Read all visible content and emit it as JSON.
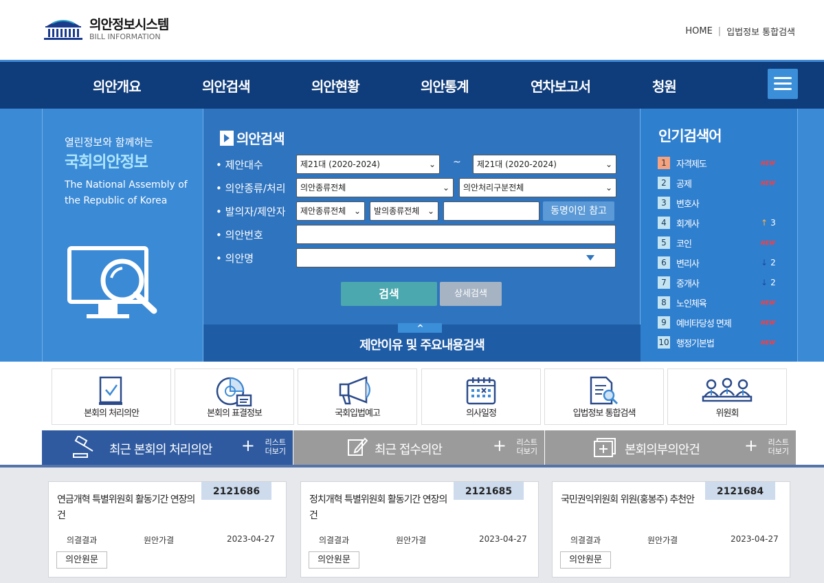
{
  "header": {
    "title": "의안정보시스템",
    "subtitle": "BILL INFORMATION",
    "util": [
      "HOME",
      "입법정보 통합검색"
    ],
    "util_sep": "|"
  },
  "nav": {
    "items": [
      "의안개요",
      "의안검색",
      "의안현황",
      "의안통계",
      "연차보고서",
      "청원"
    ],
    "menu_icon": "hamburger-icon"
  },
  "hero": {
    "line1": "열린정보와 함께하는",
    "line2": "국회의안정보",
    "line3": "The National Assembly of the Republic of Korea",
    "icon": "monitor-search-icon"
  },
  "search": {
    "title": "의안검색",
    "labels": [
      "제안대수",
      "의안종류/처리",
      "발의자/제안자",
      "의안번호",
      "의안명"
    ],
    "bullet": "•",
    "era_from": "제21대 (2020-2024)",
    "era_to": "제21대 (2020-2024)",
    "tilde": "~",
    "bill_type": "의안종류전체",
    "bill_proc": "의안처리구분전체",
    "proposer_type": "제안종류전체",
    "motion_type": "발의종류전체",
    "proposer_name": "",
    "bill_no": "",
    "bill_name": "",
    "same_name_btn": "동명이인 참고",
    "search_btn": "검색",
    "detail_btn": "상세검색",
    "reason_tab": "^",
    "reason_label": "제안이유 및 주요내용검색"
  },
  "popular": {
    "title": "인기검색어",
    "items": [
      {
        "rank": "1",
        "word": "자격제도",
        "tag": "NEW",
        "chg": ""
      },
      {
        "rank": "2",
        "word": "공제",
        "tag": "NEW",
        "chg": ""
      },
      {
        "rank": "3",
        "word": "변호사",
        "tag": "",
        "chg": ""
      },
      {
        "rank": "4",
        "word": "회계사",
        "tag": "",
        "chg": "3",
        "dir": "↑"
      },
      {
        "rank": "5",
        "word": "코인",
        "tag": "NEW",
        "chg": ""
      },
      {
        "rank": "6",
        "word": "변리사",
        "tag": "",
        "chg": "2",
        "dir": "↓"
      },
      {
        "rank": "7",
        "word": "중개사",
        "tag": "",
        "chg": "2",
        "dir": "↓"
      },
      {
        "rank": "8",
        "word": "노인체육",
        "tag": "NEW",
        "chg": ""
      },
      {
        "rank": "9",
        "word": "예비타당성 면제",
        "tag": "NEW",
        "chg": ""
      },
      {
        "rank": "10",
        "word": "행정기본법",
        "tag": "NEW",
        "chg": ""
      }
    ]
  },
  "quick": [
    {
      "label": "본회의 처리의안",
      "icon": "document-check-icon"
    },
    {
      "label": "본회의 표결정보",
      "icon": "pie-chart-doc-icon"
    },
    {
      "label": "국회입법예고",
      "icon": "megaphone-icon"
    },
    {
      "label": "의사일정",
      "icon": "calendar-icon"
    },
    {
      "label": "입법정보 통합검색",
      "icon": "document-search-icon"
    },
    {
      "label": "위원회",
      "icon": "committee-people-icon"
    }
  ],
  "tabs": [
    {
      "label": "최근 본회의 처리의안",
      "more": "리스트\n더보기",
      "plus": "+",
      "icon": "gavel-icon",
      "color": "#2f5aa0"
    },
    {
      "label": "최근 접수의안",
      "more": "리스트\n더보기",
      "plus": "+",
      "icon": "edit-icon",
      "color": "#9b9b9b"
    },
    {
      "label": "본회의부의안건",
      "more": "리스트\n더보기",
      "plus": "+",
      "icon": "add-window-icon",
      "color": "#9b9b9b"
    }
  ],
  "cards": [
    {
      "no": "2121686",
      "title": "연금개혁 특별위원회 활동기간 연장의 건",
      "result_label": "의결결과",
      "result": "원안가결",
      "date": "2023-04-27",
      "btn": "의안원문"
    },
    {
      "no": "2121685",
      "title": "정치개혁 특별위원회 활동기간 연장의 건",
      "result_label": "의결결과",
      "result": "원안가결",
      "date": "2023-04-27",
      "btn": "의안원문"
    },
    {
      "no": "2121684",
      "title": "국민권익위원회 위원(홍봉주) 추천안",
      "result_label": "의결결과",
      "result": "원안가결",
      "date": "2023-04-27",
      "btn": "의안원문"
    }
  ]
}
